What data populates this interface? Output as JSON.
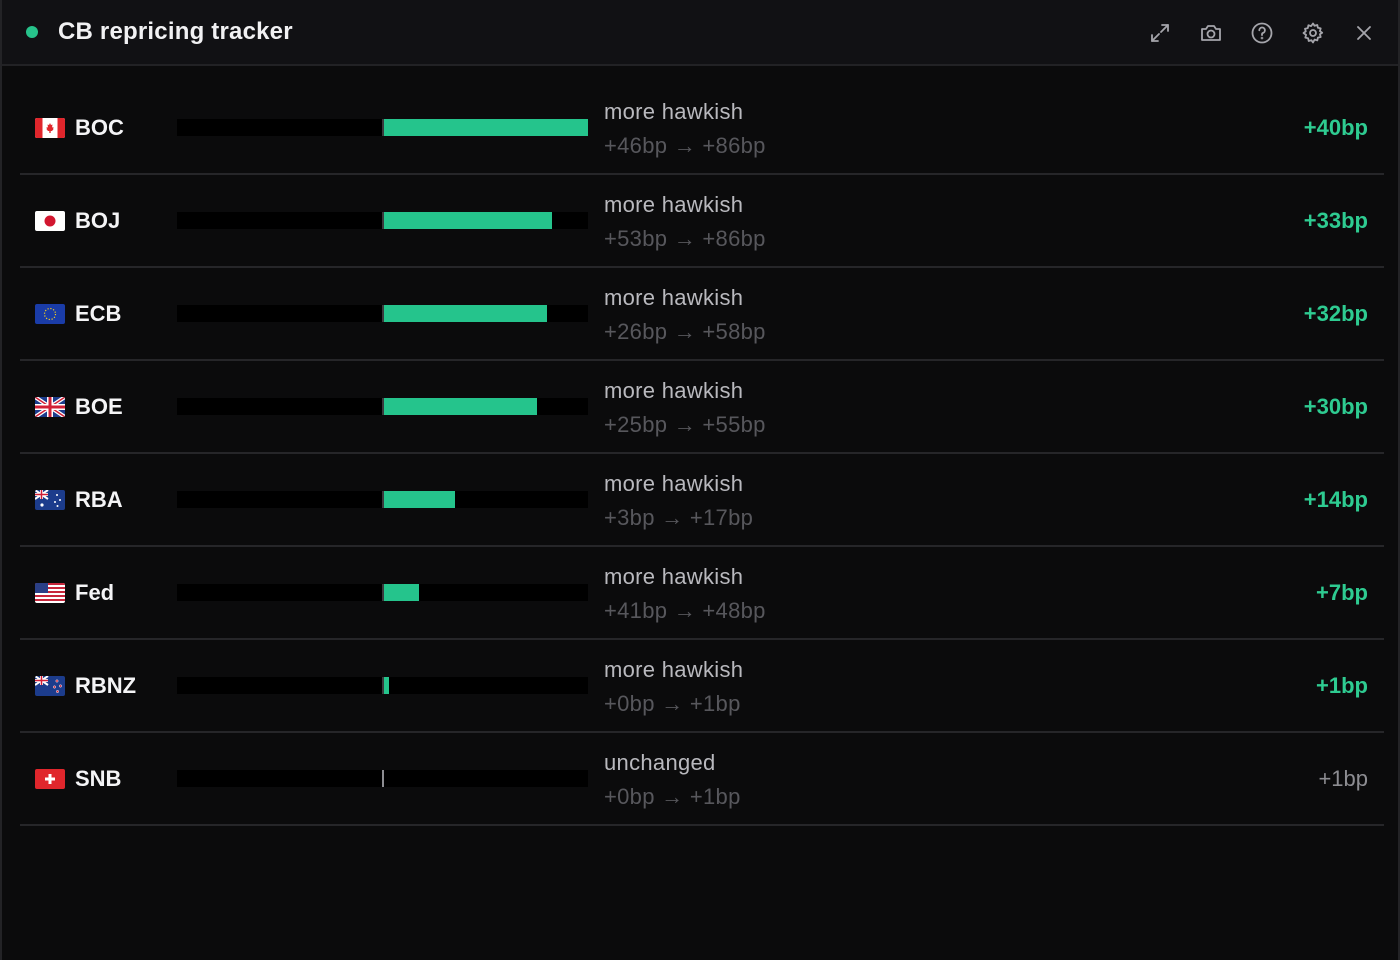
{
  "window": {
    "title": "CB repricing tracker",
    "accent": "#27c38b",
    "actions": [
      {
        "name": "expand-button",
        "icon": "expand-icon"
      },
      {
        "name": "screenshot-button",
        "icon": "camera-icon"
      },
      {
        "name": "help-button",
        "icon": "help-icon"
      },
      {
        "name": "settings-button",
        "icon": "gear-icon"
      },
      {
        "name": "close-button",
        "icon": "close-icon"
      }
    ]
  },
  "rows": [
    {
      "code": "BOC",
      "flag": "canada-flag-icon",
      "status": "more hawkish",
      "range": "+46bp → +86bp",
      "change": "+40bp",
      "change_value": 40,
      "highlight": true
    },
    {
      "code": "BOJ",
      "flag": "japan-flag-icon",
      "status": "more hawkish",
      "range": "+53bp → +86bp",
      "change": "+33bp",
      "change_value": 33,
      "highlight": true
    },
    {
      "code": "ECB",
      "flag": "eu-flag-icon",
      "status": "more hawkish",
      "range": "+26bp → +58bp",
      "change": "+32bp",
      "change_value": 32,
      "highlight": true
    },
    {
      "code": "BOE",
      "flag": "uk-flag-icon",
      "status": "more hawkish",
      "range": "+25bp → +55bp",
      "change": "+30bp",
      "change_value": 30,
      "highlight": true
    },
    {
      "code": "RBA",
      "flag": "australia-flag-icon",
      "status": "more hawkish",
      "range": "+3bp → +17bp",
      "change": "+14bp",
      "change_value": 14,
      "highlight": true
    },
    {
      "code": "Fed",
      "flag": "us-flag-icon",
      "status": "more hawkish",
      "range": "+41bp → +48bp",
      "change": "+7bp",
      "change_value": 7,
      "highlight": true
    },
    {
      "code": "RBNZ",
      "flag": "nz-flag-icon",
      "status": "more hawkish",
      "range": "+0bp → +1bp",
      "change": "+1bp",
      "change_value": 1,
      "highlight": true
    },
    {
      "code": "SNB",
      "flag": "switzerland-flag-icon",
      "status": "unchanged",
      "range": "+0bp → +1bp",
      "change": "+1bp",
      "change_value": 1,
      "highlight": false
    }
  ],
  "scale_max_bp": 40,
  "bar_color": "#25c48c",
  "neutral_color": "#8d8d92"
}
